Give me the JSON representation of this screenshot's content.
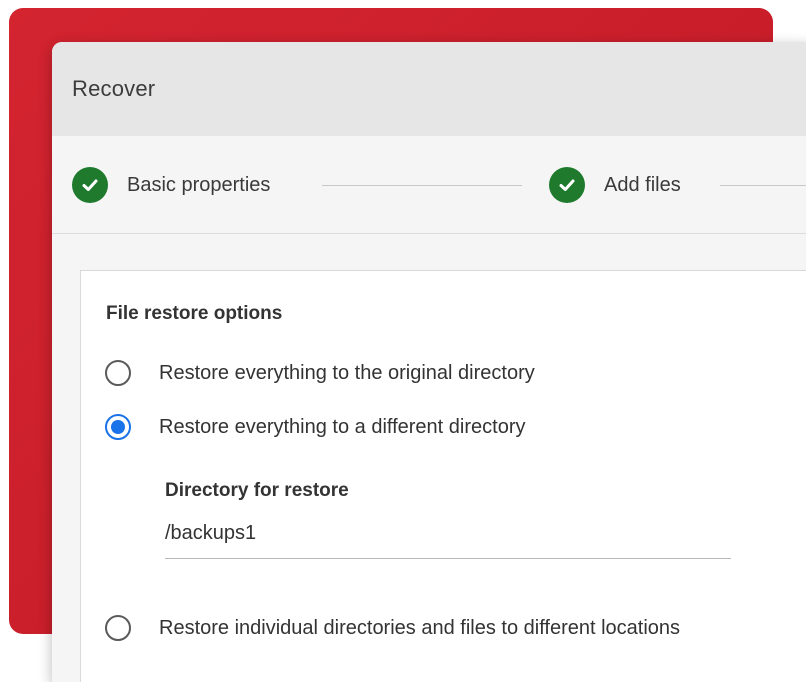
{
  "dialog": {
    "title": "Recover"
  },
  "steps": [
    {
      "label": "Basic properties",
      "status": "complete",
      "icon": "check-circle-icon"
    },
    {
      "label": "Add files",
      "status": "complete",
      "icon": "check-circle-icon"
    }
  ],
  "restore": {
    "section_title": "File restore options",
    "options": [
      {
        "label": "Restore everything to the original directory",
        "selected": false
      },
      {
        "label": "Restore everything to a different directory",
        "selected": true
      },
      {
        "label": "Restore individual directories and files to different locations",
        "selected": false
      }
    ],
    "directory": {
      "label": "Directory for restore",
      "value": "/backups1"
    }
  },
  "colors": {
    "accent_red": "#c81e2a",
    "step_complete_green": "#1f7a2e",
    "radio_selected_blue": "#1a73e8",
    "header_gray": "#e6e6e6"
  }
}
